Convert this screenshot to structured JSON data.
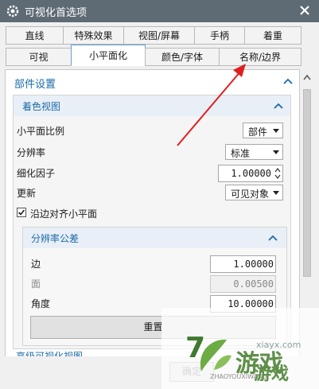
{
  "window": {
    "title": "可视化首选项",
    "icon": "gear-icon",
    "close_icon": "close-icon"
  },
  "tabs": {
    "row1": [
      "直线",
      "特殊效果",
      "视图/屏幕",
      "手柄",
      "着重"
    ],
    "row2": [
      "可视",
      "小平面化",
      "颜色/字体",
      "名称/边界"
    ],
    "active": "小平面化"
  },
  "section": {
    "title": "部件设置",
    "group1": {
      "title": "着色视图",
      "facet_ratio": {
        "label": "小平面比例",
        "value": "部件"
      },
      "resolution": {
        "label": "分辨率",
        "value": "标准"
      },
      "refine_factor": {
        "label": "细化因子",
        "value": "1.00000"
      },
      "update": {
        "label": "更新",
        "value": "可见对象"
      },
      "align": {
        "label": "沿边对齐小平面",
        "checked": true
      }
    },
    "group2": {
      "title": "分辨率公差",
      "edge": {
        "label": "边",
        "value": "1.00000"
      },
      "face": {
        "label": "面",
        "value": "0.00500"
      },
      "angle": {
        "label": "角度",
        "value": "10.00000"
      },
      "reset": "重置"
    },
    "next_group": "高级可视化视图"
  },
  "footer": {
    "ok": "确定"
  },
  "watermark": {
    "line1": "xiayx.com",
    "line2": "游戏",
    "line3": "ZHAOYOUXIWANG",
    "line4": "游戏"
  },
  "colors": {
    "titlebar": "#5f6b74",
    "accent": "#1a6aa8",
    "arrow": "#e02020"
  }
}
